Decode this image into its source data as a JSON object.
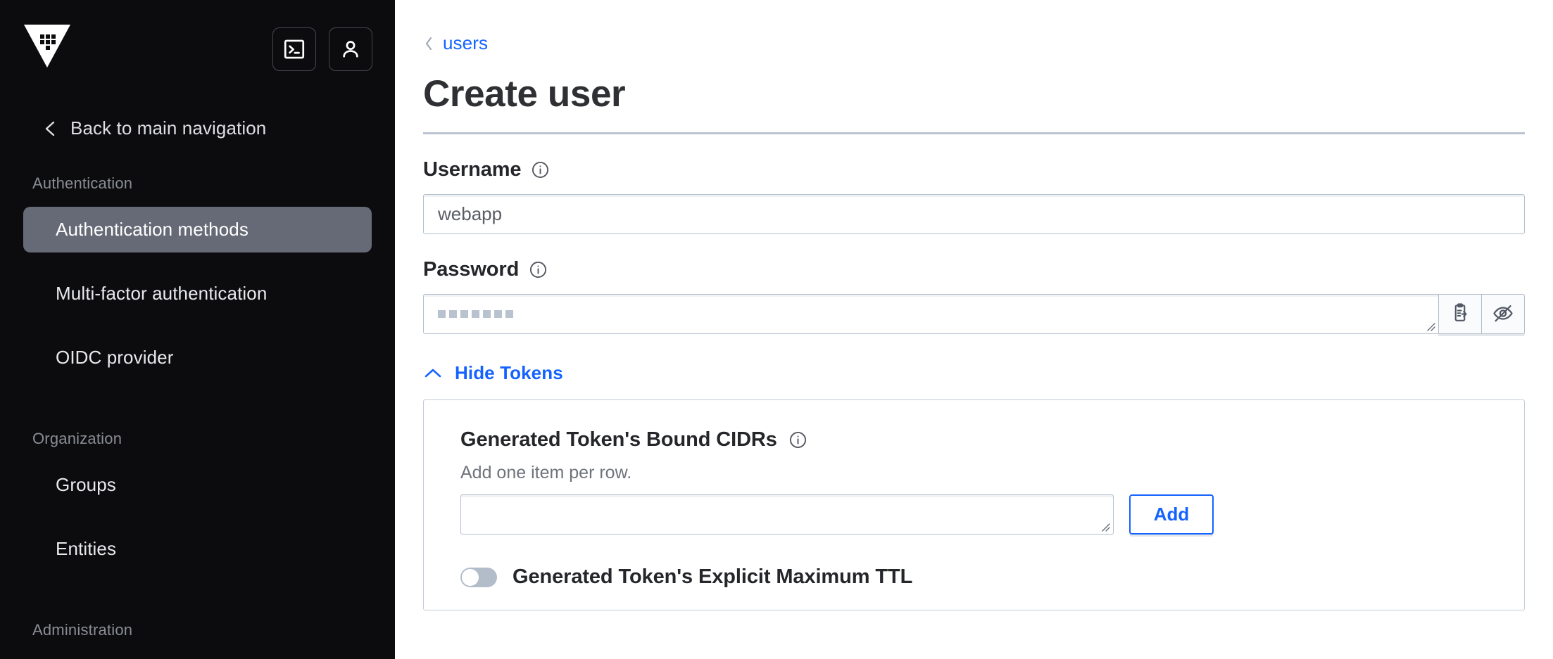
{
  "sidebar": {
    "logo_name": "vault-logo",
    "top_actions": [
      {
        "name": "console-toggle-button",
        "icon": "terminal-icon",
        "label": "Console"
      },
      {
        "name": "user-menu-button",
        "icon": "user-icon",
        "label": "User"
      }
    ],
    "back_nav": {
      "icon": "chevron-left-icon",
      "label": "Back to main navigation"
    },
    "sections": [
      {
        "heading": "Authentication",
        "items": [
          {
            "label": "Authentication methods",
            "active": true
          },
          {
            "label": "Multi-factor authentication",
            "active": false
          },
          {
            "label": "OIDC provider",
            "active": false
          }
        ]
      },
      {
        "heading": "Organization",
        "items": [
          {
            "label": "Groups",
            "active": false
          },
          {
            "label": "Entities",
            "active": false
          }
        ]
      },
      {
        "heading": "Administration",
        "items": []
      }
    ]
  },
  "main": {
    "breadcrumb": {
      "icon": "chevron-left-icon",
      "label": "users"
    },
    "page_title": "Create user",
    "username_field": {
      "label": "Username",
      "info_icon": "info-circle-icon",
      "value": "webapp",
      "placeholder": "webapp"
    },
    "password_field": {
      "label": "Password",
      "info_icon": "info-circle-icon",
      "masked_value": "▪▪▪▪▪▪▪",
      "mask_count": 7,
      "copy_button": {
        "name": "copy-password-button",
        "icon": "clipboard-copy-icon"
      },
      "hide_button": {
        "name": "toggle-password-visibility-button",
        "icon": "eye-off-icon"
      }
    },
    "tokens_disclosure": {
      "icon": "chevron-up-icon",
      "label": "Hide Tokens"
    },
    "tokens_card": {
      "cidrs": {
        "title": "Generated Token's Bound CIDRs",
        "info_icon": "info-circle-icon",
        "help": "Add one item per row.",
        "input_value": "",
        "add_label": "Add"
      },
      "ttl_toggle": {
        "label": "Generated Token's Explicit Maximum TTL",
        "enabled": false
      }
    }
  },
  "colors": {
    "sidebar_bg": "#0c0c0e",
    "sidebar_active": "#656a76",
    "accent_blue": "#1563ff",
    "border_grey": "#b4bfcd",
    "rule_grey": "#bac3d0",
    "text_dark": "#25262a",
    "text_muted": "#6f737b"
  }
}
